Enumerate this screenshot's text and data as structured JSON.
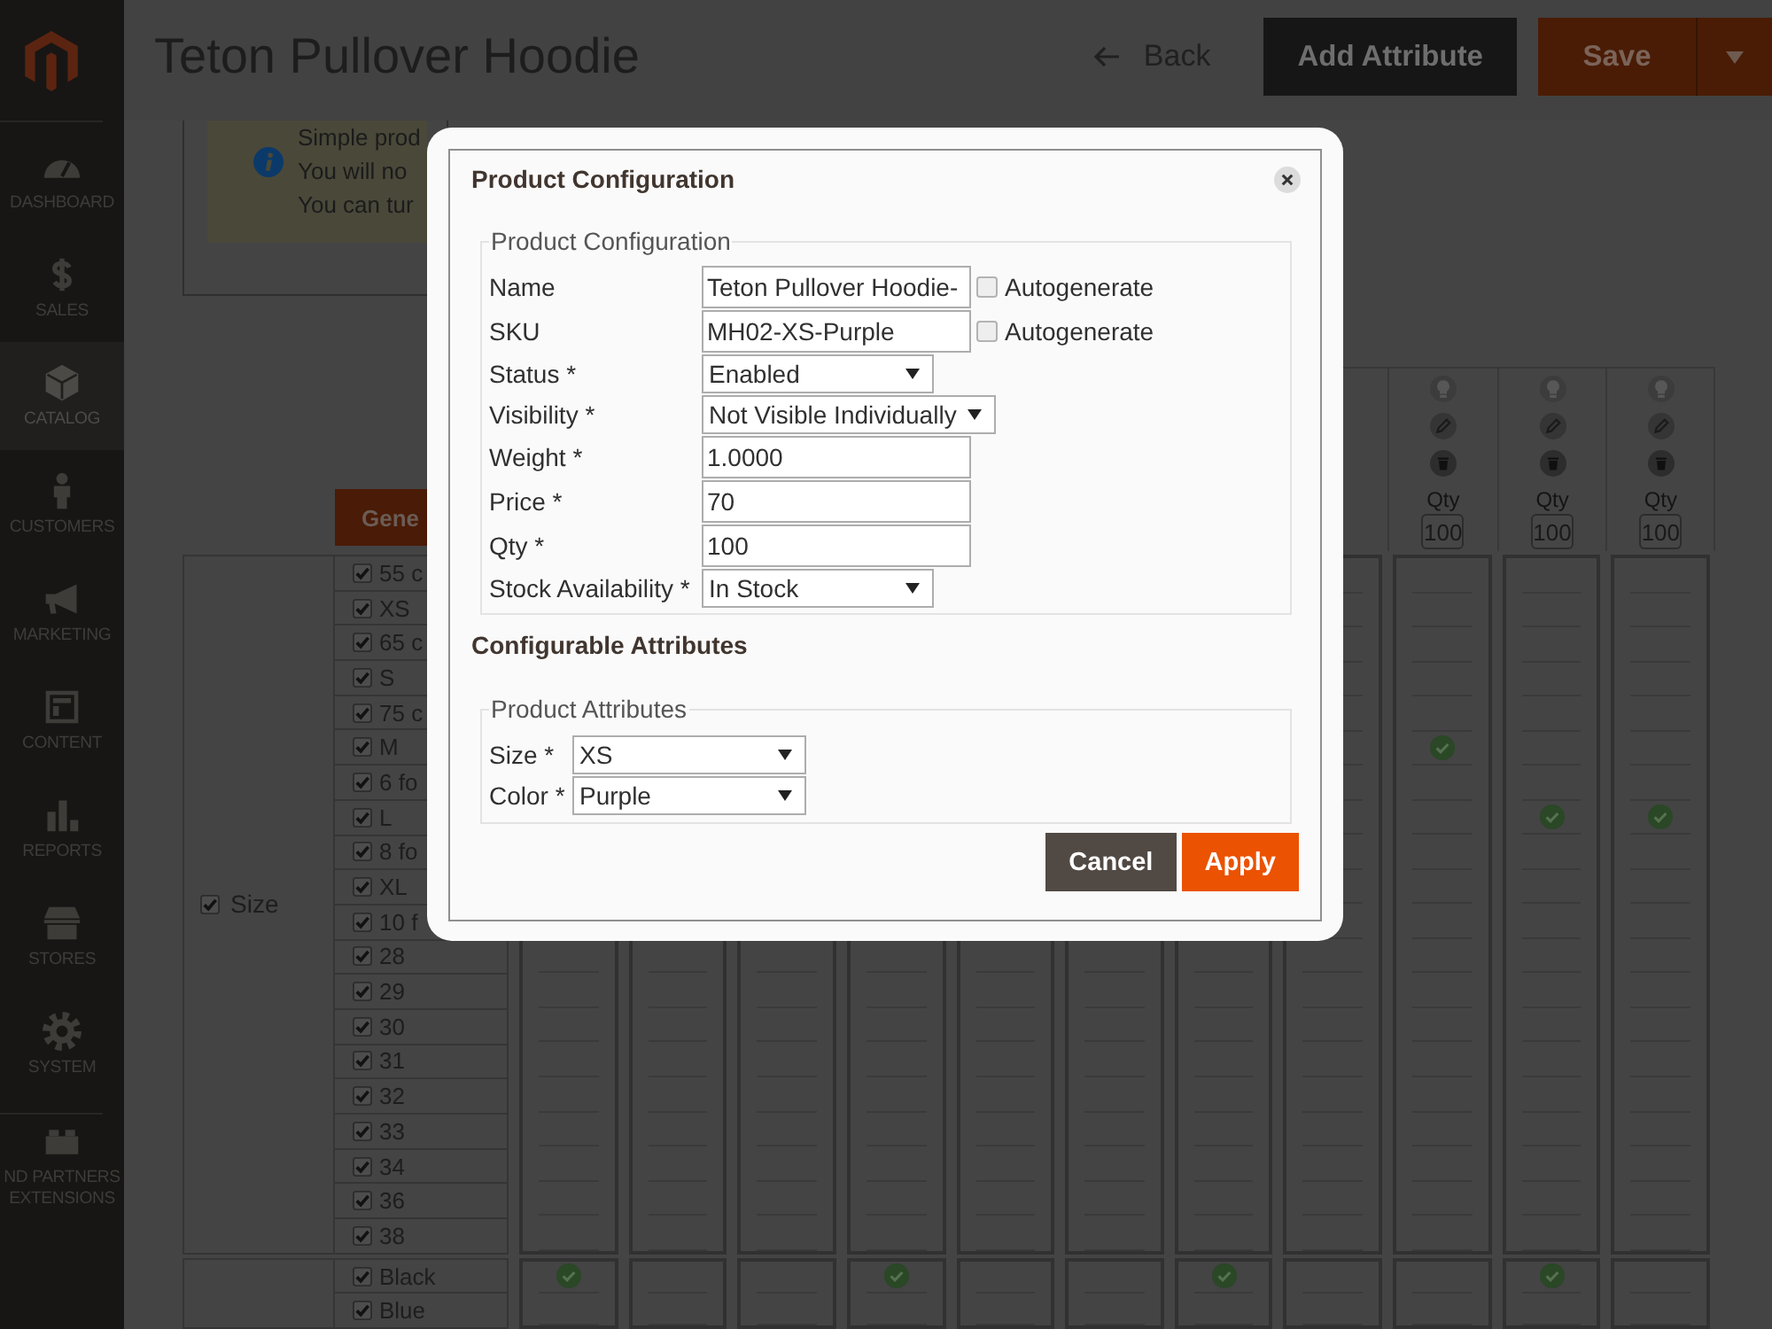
{
  "sidebar": {
    "items": [
      {
        "label": "DASHBOARD",
        "selected": false
      },
      {
        "label": "SALES",
        "selected": false
      },
      {
        "label": "CATALOG",
        "selected": true
      },
      {
        "label": "CUSTOMERS",
        "selected": false
      },
      {
        "label": "MARKETING",
        "selected": false
      },
      {
        "label": "CONTENT",
        "selected": false
      },
      {
        "label": "REPORTS",
        "selected": false
      },
      {
        "label": "STORES",
        "selected": false
      },
      {
        "label": "SYSTEM",
        "selected": false
      },
      {
        "label": "ND PARTNERS EXTENSIONS",
        "selected": false
      }
    ]
  },
  "header": {
    "title": "Teton Pullover Hoodie",
    "back": "Back",
    "add_attribute": "Add Attribute",
    "save": "Save"
  },
  "notice": {
    "lines": [
      "Simple prod",
      "You will no",
      "You can tur"
    ]
  },
  "matrix": {
    "generate_button": "Gene",
    "column_headers": [
      {
        "qty_label": "Qty",
        "qty": "100"
      },
      {
        "qty_label": "Qty",
        "qty": "100"
      },
      {
        "qty_label": "Qty",
        "qty": "100"
      }
    ],
    "attributes": [
      {
        "label": "Size",
        "checked": true,
        "values": [
          {
            "label": "55 c",
            "checked": true,
            "cells": [
              {
                "checked": false
              },
              {
                "checked": false
              },
              {
                "checked": false
              }
            ]
          },
          {
            "label": "XS",
            "checked": true,
            "cells": [
              {
                "checked": false
              },
              {
                "checked": false
              },
              {
                "checked": false
              }
            ]
          },
          {
            "label": "65 c",
            "checked": true,
            "cells": [
              {
                "checked": false
              },
              {
                "checked": false
              },
              {
                "checked": false
              }
            ]
          },
          {
            "label": "S",
            "checked": true,
            "cells": [
              {
                "checked": false
              },
              {
                "checked": false
              },
              {
                "checked": false
              }
            ]
          },
          {
            "label": "75 c",
            "checked": true,
            "cells": [
              {
                "checked": false
              },
              {
                "checked": false
              },
              {
                "checked": false
              }
            ]
          },
          {
            "label": "M",
            "checked": true,
            "cells": [
              {
                "checked": true
              },
              {
                "checked": false
              },
              {
                "checked": false
              }
            ]
          },
          {
            "label": "6 fo",
            "checked": true,
            "cells": [
              {
                "checked": false
              },
              {
                "checked": false
              },
              {
                "checked": false
              }
            ]
          },
          {
            "label": "L",
            "checked": true,
            "cells": [
              {
                "checked": false
              },
              {
                "checked": true
              },
              {
                "checked": true
              }
            ]
          },
          {
            "label": "8 fo",
            "checked": true,
            "cells": [
              {
                "checked": false
              },
              {
                "checked": false
              },
              {
                "checked": false
              }
            ]
          },
          {
            "label": "XL",
            "checked": true,
            "cells": [
              {
                "checked": false
              },
              {
                "checked": false
              },
              {
                "checked": false
              }
            ]
          },
          {
            "label": "10 f",
            "checked": true,
            "cells": [
              {
                "checked": false
              },
              {
                "checked": false
              },
              {
                "checked": false
              }
            ]
          },
          {
            "label": "28",
            "checked": true,
            "cells": [
              {
                "checked": false
              },
              {
                "checked": false
              },
              {
                "checked": false
              },
              {
                "checked": false
              },
              {
                "checked": false
              },
              {
                "checked": false
              },
              {
                "checked": false
              },
              {
                "checked": false
              },
              {
                "checked": false
              },
              {
                "checked": false
              },
              {
                "checked": false
              }
            ]
          },
          {
            "label": "29",
            "checked": true,
            "cells": [
              {
                "checked": false
              },
              {
                "checked": false
              },
              {
                "checked": false
              },
              {
                "checked": false
              },
              {
                "checked": false
              },
              {
                "checked": false
              },
              {
                "checked": false
              },
              {
                "checked": false
              },
              {
                "checked": false
              },
              {
                "checked": false
              },
              {
                "checked": false
              }
            ]
          },
          {
            "label": "30",
            "checked": true,
            "cells": [
              {
                "checked": false
              },
              {
                "checked": false
              },
              {
                "checked": false
              },
              {
                "checked": false
              },
              {
                "checked": false
              },
              {
                "checked": false
              },
              {
                "checked": false
              },
              {
                "checked": false
              },
              {
                "checked": false
              },
              {
                "checked": false
              },
              {
                "checked": false
              }
            ]
          },
          {
            "label": "31",
            "checked": true,
            "cells": [
              {
                "checked": false
              },
              {
                "checked": false
              },
              {
                "checked": false
              },
              {
                "checked": false
              },
              {
                "checked": false
              },
              {
                "checked": false
              },
              {
                "checked": false
              },
              {
                "checked": false
              },
              {
                "checked": false
              },
              {
                "checked": false
              },
              {
                "checked": false
              }
            ]
          },
          {
            "label": "32",
            "checked": true,
            "cells": [
              {
                "checked": false
              },
              {
                "checked": false
              },
              {
                "checked": false
              },
              {
                "checked": false
              },
              {
                "checked": false
              },
              {
                "checked": false
              },
              {
                "checked": false
              },
              {
                "checked": false
              },
              {
                "checked": false
              },
              {
                "checked": false
              },
              {
                "checked": false
              }
            ]
          },
          {
            "label": "33",
            "checked": true,
            "cells": [
              {
                "checked": false
              },
              {
                "checked": false
              },
              {
                "checked": false
              },
              {
                "checked": false
              },
              {
                "checked": false
              },
              {
                "checked": false
              },
              {
                "checked": false
              },
              {
                "checked": false
              },
              {
                "checked": false
              },
              {
                "checked": false
              },
              {
                "checked": false
              }
            ]
          },
          {
            "label": "34",
            "checked": true,
            "cells": [
              {
                "checked": false
              },
              {
                "checked": false
              },
              {
                "checked": false
              },
              {
                "checked": false
              },
              {
                "checked": false
              },
              {
                "checked": false
              },
              {
                "checked": false
              },
              {
                "checked": false
              },
              {
                "checked": false
              },
              {
                "checked": false
              },
              {
                "checked": false
              }
            ]
          },
          {
            "label": "36",
            "checked": true,
            "cells": [
              {
                "checked": false
              },
              {
                "checked": false
              },
              {
                "checked": false
              },
              {
                "checked": false
              },
              {
                "checked": false
              },
              {
                "checked": false
              },
              {
                "checked": false
              },
              {
                "checked": false
              },
              {
                "checked": false
              },
              {
                "checked": false
              },
              {
                "checked": false
              }
            ]
          },
          {
            "label": "38",
            "checked": true,
            "cells": [
              {
                "checked": false
              },
              {
                "checked": false
              },
              {
                "checked": false
              },
              {
                "checked": false
              },
              {
                "checked": false
              },
              {
                "checked": false
              },
              {
                "checked": false
              },
              {
                "checked": false
              },
              {
                "checked": false
              },
              {
                "checked": false
              },
              {
                "checked": false
              }
            ]
          }
        ]
      },
      {
        "values": [
          {
            "label": "Black",
            "checked": true,
            "cells": [
              {
                "checked": true
              },
              {
                "checked": false
              },
              {
                "checked": false
              },
              {
                "checked": true
              },
              {
                "checked": false
              },
              {
                "checked": false
              },
              {
                "checked": true
              },
              {
                "checked": false
              },
              {
                "checked": false
              },
              {
                "checked": true
              },
              {
                "checked": false
              }
            ]
          },
          {
            "label": "Blue",
            "checked": true,
            "cells": [
              {
                "checked": false
              },
              {
                "checked": false
              },
              {
                "checked": false
              },
              {
                "checked": false
              },
              {
                "checked": false
              },
              {
                "checked": false
              },
              {
                "checked": false
              },
              {
                "checked": false
              },
              {
                "checked": false
              },
              {
                "checked": false
              },
              {
                "checked": false
              }
            ]
          }
        ]
      }
    ]
  },
  "dialog": {
    "title": "Product Configuration",
    "product_configuration": {
      "legend": "Product Configuration",
      "fields": [
        {
          "kind": "text",
          "label": "Name",
          "value": "Teton Pullover Hoodie-",
          "autogenerate": {
            "label": "Autogenerate",
            "checked": false
          }
        },
        {
          "kind": "text",
          "label": "SKU",
          "value": "MH02-XS-Purple",
          "autogenerate": {
            "label": "Autogenerate",
            "checked": false
          }
        },
        {
          "kind": "select",
          "label": "Status *",
          "value": "Enabled"
        },
        {
          "kind": "select",
          "label": "Visibility *",
          "value": "Not Visible Individually"
        },
        {
          "kind": "text",
          "label": "Weight *",
          "value": "1.0000"
        },
        {
          "kind": "text",
          "label": "Price *",
          "value": "70"
        },
        {
          "kind": "text",
          "label": "Qty *",
          "value": "100"
        },
        {
          "kind": "select",
          "label": "Stock Availability *",
          "value": "In Stock"
        }
      ]
    },
    "section_title": "Configurable Attributes",
    "product_attributes": {
      "legend": "Product Attributes",
      "fields": [
        {
          "kind": "select",
          "label": "Size *",
          "value": "XS"
        },
        {
          "kind": "select",
          "label": "Color *",
          "value": "Purple"
        }
      ]
    },
    "buttons": [
      {
        "kind": "cancel",
        "label": "Cancel"
      },
      {
        "kind": "apply",
        "label": "Apply"
      }
    ]
  }
}
